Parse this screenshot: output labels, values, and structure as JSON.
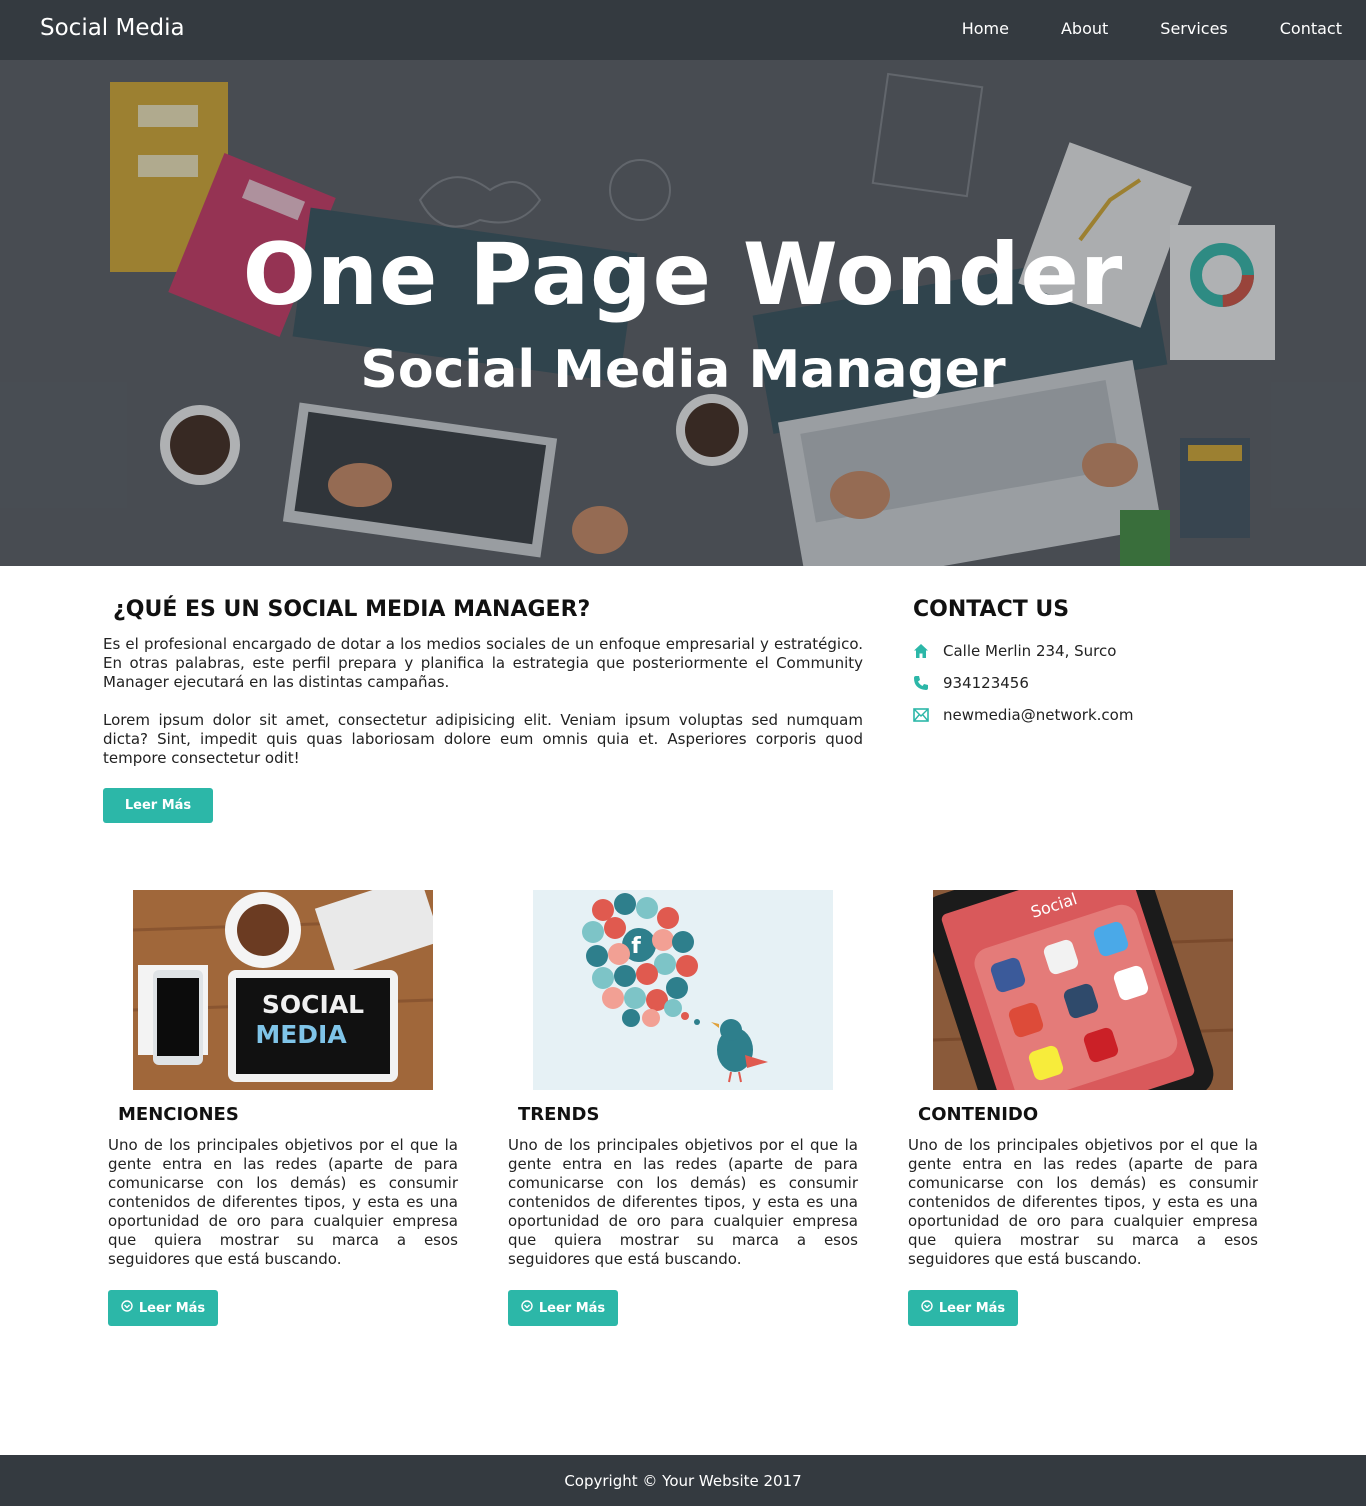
{
  "nav": {
    "brand": "Social Media",
    "links": [
      "Home",
      "About",
      "Services",
      "Contact"
    ]
  },
  "hero": {
    "title": "One Page Wonder",
    "subtitle": "Social Media Manager"
  },
  "about": {
    "heading": "¿QUÉ ES UN SOCIAL MEDIA MANAGER?",
    "paragraph1": "Es el profesional encargado de dotar a los medios sociales de un enfoque empresarial y estratégico. En otras palabras, este perfil prepara y planifica la estrategia que posteriormente el Community Manager ejecutará en las distintas campañas.",
    "paragraph2": "Lorem ipsum dolor sit amet, consectetur adipisicing elit. Veniam ipsum voluptas sed numquam dicta? Sint, impedit quis quas laboriosam dolore eum omnis quia et. Asperiores corporis quod tempore consectetur odit!",
    "button": "Leer Más"
  },
  "contact": {
    "heading": "CONTACT US",
    "address": "Calle Merlin 234, Surco",
    "phone": "934123456",
    "email": "newmedia@network.com",
    "icons": [
      "home-icon",
      "phone-icon",
      "envelope-icon"
    ]
  },
  "cards": [
    {
      "title": "MENCIONES",
      "image_text": [
        "SOCIAL",
        "MEDIA"
      ],
      "text": "Uno de los principales objetivos por el que la gente entra en las redes (aparte de para comunicarse con los demás) es consumir contenidos de diferentes tipos, y esta es una oportunidad de oro para cualquier empresa que quiera mostrar su marca a esos seguidores que está buscando.",
      "button": "Leer Más"
    },
    {
      "title": "TRENDS",
      "text": "Uno de los principales objetivos por el que la gente entra en las redes (aparte de para comunicarse con los demás) es consumir contenidos de diferentes tipos, y esta es una oportunidad de oro para cualquier empresa que quiera mostrar su marca a esos seguidores que está buscando.",
      "button": "Leer Más"
    },
    {
      "title": "CONTENIDO",
      "image_text": "Social",
      "text": "Uno de los principales objetivos por el que la gente entra en las redes (aparte de para comunicarse con los demás) es consumir contenidos de diferentes tipos, y esta es una oportunidad de oro para cualquier empresa que quiera mostrar su marca a esos seguidores que está buscando.",
      "button": "Leer Más"
    }
  ],
  "footer": {
    "copyright": "Copyright © Your Website 2017"
  },
  "colors": {
    "navbar": "#343a40",
    "accent": "#2cb7a8",
    "footer": "#343a40"
  }
}
